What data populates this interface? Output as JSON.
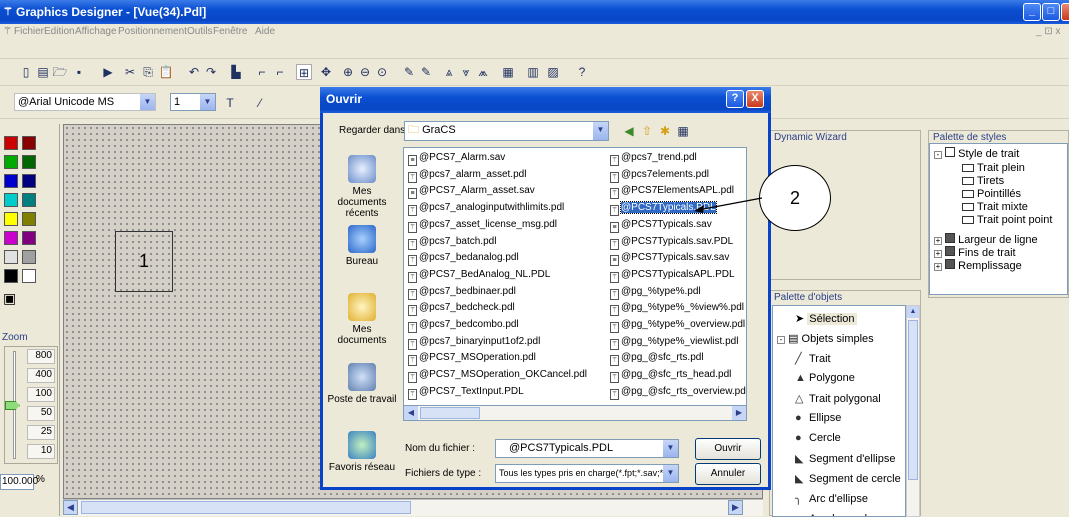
{
  "window": {
    "title": "Graphics Designer - [Vue(34).Pdl]",
    "app_icon": "app-icon"
  },
  "menu": [
    "Fichier",
    "Edition",
    "Affichage",
    "Positionnement",
    "Outils",
    "Fenêtre",
    "Aide"
  ],
  "font_toolbar": {
    "font": "@Arial Unicode MS",
    "size": "1"
  },
  "left_panel": {
    "zoom_title": "Zoom",
    "zoom_levels": [
      "800",
      "400",
      "100",
      "50",
      "25",
      "10"
    ],
    "zoom_value": "100.000",
    "zoom_unit": "%",
    "colors": [
      [
        "#cc0000",
        "#880000"
      ],
      [
        "#00aa00",
        "#006600"
      ],
      [
        "#0000cc",
        "#000080"
      ],
      [
        "#00cccc",
        "#008080"
      ],
      [
        "#ffff00",
        "#808000"
      ],
      [
        "#cc00cc",
        "#800080"
      ],
      [
        "#e0e0e0",
        "#a0a0a0"
      ],
      [
        "#000000",
        "#ffffff"
      ]
    ]
  },
  "canvas": {
    "box1_label": "1"
  },
  "callout2": {
    "label": "2"
  },
  "dialog": {
    "title": "Ouvrir",
    "look_in_label": "Regarder dans :",
    "look_in_value": "GraCS",
    "places": [
      "Mes documents récents",
      "Bureau",
      "Mes documents",
      "Poste de travail",
      "Favoris réseau"
    ],
    "files_col1": [
      "@PCS7_Alarm.sav",
      "@pcs7_alarm_asset.pdl",
      "@PCS7_Alarm_asset.sav",
      "@pcs7_analoginputwithlimits.pdl",
      "@pcs7_asset_license_msg.pdl",
      "@pcs7_batch.pdl",
      "@pcs7_bedanalog.pdl",
      "@PCS7_BedAnalog_NL.PDL",
      "@pcs7_bedbinaer.pdl",
      "@pcs7_bedcheck.pdl",
      "@pcs7_bedcombo.pdl",
      "@pcs7_binaryinput1of2.pdl",
      "@PCS7_MSOperation.pdl",
      "@PCS7_MSOperation_OKCancel.pdl",
      "@PCS7_TextInput.PDL"
    ],
    "files_col2": [
      "@pcs7_trend.pdl",
      "@pcs7elements.pdl",
      "@PCS7ElementsAPL.pdl",
      "@PCS7Typicals.PDL",
      "@PCS7Typicals.sav",
      "@PCS7Typicals.sav.PDL",
      "@PCS7Typicals.sav.sav",
      "@PCS7TypicalsAPL.PDL",
      "@pg_%type%.pdl",
      "@pg_%type%_%view%.pdl",
      "@pg_%type%_overview.pdl",
      "@pg_%type%_viewlist.pdl",
      "@pg_@sfc_rts.pdl",
      "@pg_@sfc_rts_head.pdl",
      "@pg_@sfc_rts_overview.pdl"
    ],
    "col1_sav_rows": [
      0,
      2
    ],
    "col2_sav_rows": [
      4,
      6
    ],
    "selected_file": "@PCS7Typicals.PDL",
    "filename_label": "Nom du fichier :",
    "filename_value": "@PCS7Typicals.PDL",
    "filetype_label": "Fichiers de type :",
    "filetype_value": "Tous les types pris en charge(*.fpt;*.sav;*.saf;*.",
    "open_button": "Ouvrir",
    "cancel_button": "Annuler"
  },
  "dynamic_wizard": {
    "title": "Dynamic Wizard"
  },
  "style_palette": {
    "title": "Palette de styles",
    "root": "Style de trait",
    "items": [
      "Trait plein",
      "Tirets",
      "Pointillés",
      "Trait mixte",
      "Trait point point"
    ],
    "groups": [
      "Largeur de ligne",
      "Fins de trait",
      "Remplissage"
    ]
  },
  "object_palette": {
    "title": "Palette d'objets",
    "selection": "Sélection",
    "group": "Objets simples",
    "items": [
      "Trait",
      "Polygone",
      "Trait polygonal",
      "Ellipse",
      "Cercle",
      "Segment d'ellipse",
      "Segment de cercle",
      "Arc d'ellipse",
      "Arc de cercle"
    ]
  }
}
